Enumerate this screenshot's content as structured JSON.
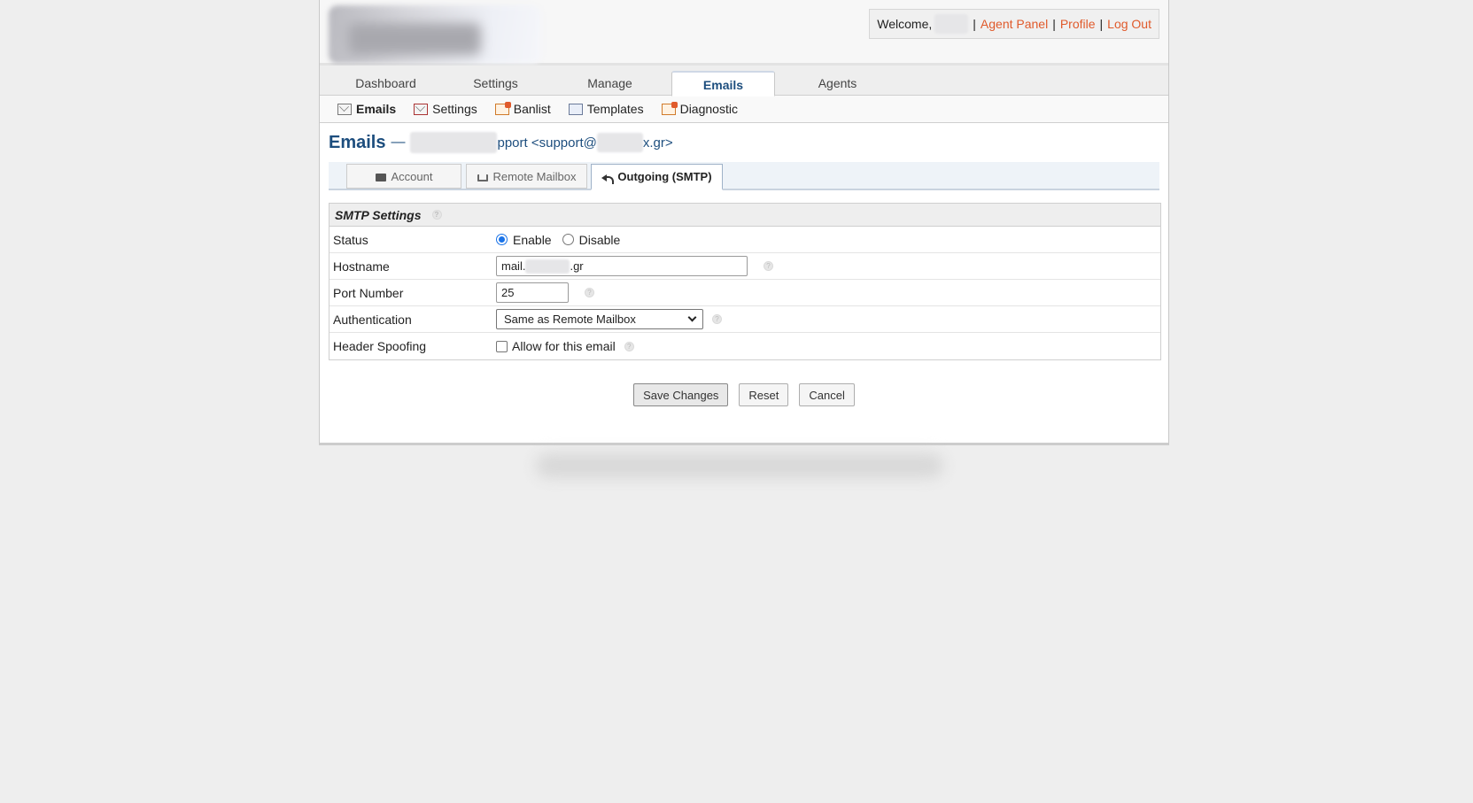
{
  "header": {
    "welcome_label": "Welcome,",
    "user_name": "",
    "sep": "|",
    "agent_panel": "Agent Panel",
    "profile": "Profile",
    "logout": "Log Out"
  },
  "nav": {
    "tabs": [
      {
        "label": "Dashboard"
      },
      {
        "label": "Settings"
      },
      {
        "label": "Manage"
      },
      {
        "label": "Emails"
      },
      {
        "label": "Agents"
      }
    ]
  },
  "subnav": {
    "items": [
      {
        "label": "Emails"
      },
      {
        "label": "Settings"
      },
      {
        "label": "Banlist"
      },
      {
        "label": "Templates"
      },
      {
        "label": "Diagnostic"
      }
    ]
  },
  "page": {
    "title": "Emails",
    "dash": "—",
    "address_visible": "pport <support@",
    "address_tail": "x.gr>"
  },
  "tabs": [
    {
      "label": "Account"
    },
    {
      "label": "Remote Mailbox"
    },
    {
      "label": "Outgoing (SMTP)"
    }
  ],
  "smtp": {
    "heading": "SMTP Settings",
    "status_label": "Status",
    "enable_label": "Enable",
    "disable_label": "Disable",
    "hostname_label": "Hostname",
    "hostname_prefix": "mail.",
    "hostname_suffix": ".gr",
    "port_label": "Port Number",
    "port_value": "25",
    "auth_label": "Authentication",
    "auth_value": "Same as Remote Mailbox",
    "spoof_label": "Header Spoofing",
    "spoof_option": "Allow for this email",
    "help_glyph": "?"
  },
  "buttons": {
    "save": "Save Changes",
    "reset": "Reset",
    "cancel": "Cancel"
  },
  "colors": {
    "link": "#e05a2b",
    "title": "#1d4e7e",
    "radio_selected": "#1a73e8"
  }
}
